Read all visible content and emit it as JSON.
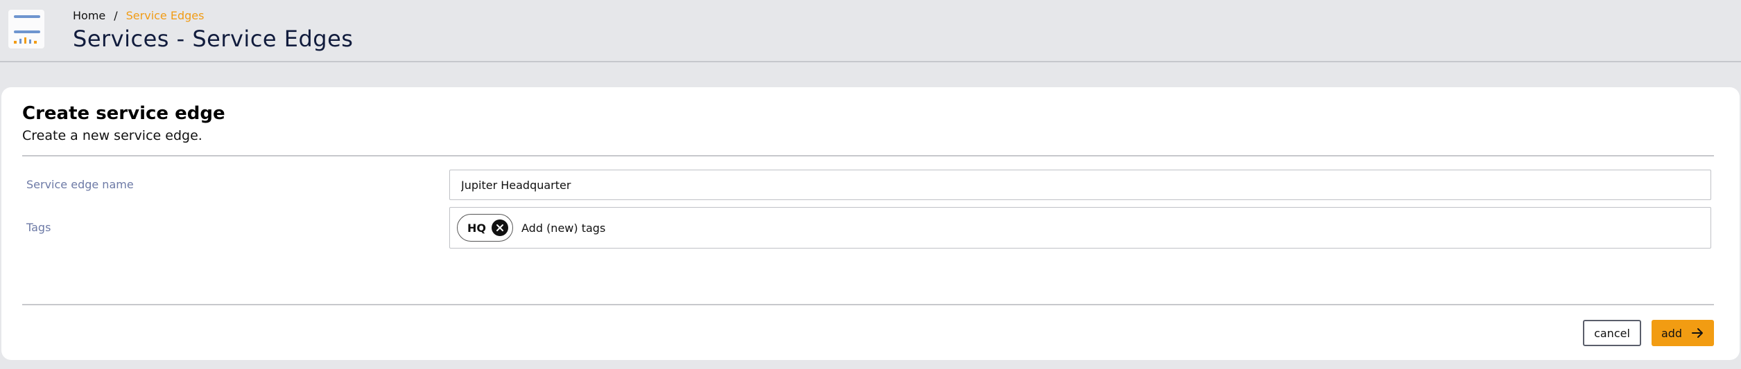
{
  "breadcrumb": {
    "home": "Home",
    "separator": "/",
    "current": "Service Edges"
  },
  "header": {
    "title": "Services - Service Edges"
  },
  "form": {
    "title": "Create service edge",
    "subtitle": "Create a new service edge.",
    "name_label": "Service edge name",
    "name_value": "Jupiter Headquarter",
    "tags_label": "Tags",
    "tags": [
      {
        "label": "HQ"
      }
    ],
    "tags_placeholder": "Add (new) tags"
  },
  "actions": {
    "cancel_label": "cancel",
    "add_label": "add"
  },
  "colors": {
    "accent": "#f29c12",
    "breadcrumb_current": "#f19c16",
    "label": "#6d7aa6"
  },
  "icons": {
    "logo": "service-edges-logo-icon",
    "chip_remove": "close-circle-icon",
    "add_arrow": "arrow-right-icon"
  }
}
